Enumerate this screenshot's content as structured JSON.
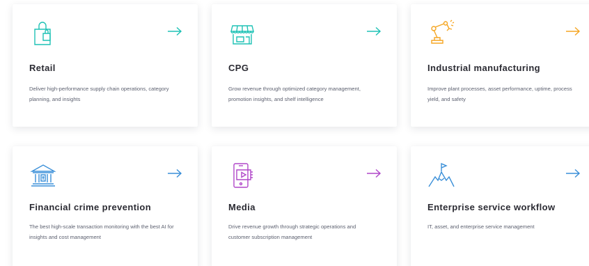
{
  "cards": [
    {
      "title": "Retail",
      "description": "Deliver high-performance supply chain operations, category planning, and insights",
      "icon": "shopping-bag-icon",
      "accent": "#1fc2b5"
    },
    {
      "title": "CPG",
      "description": "Grow revenue through optimized category management, promotion insights, and shelf intelligence",
      "icon": "storefront-icon",
      "accent": "#1fc2b5"
    },
    {
      "title": "Industrial manufacturing",
      "description": "Improve plant processes, asset performance, uptime, process yield, and safety",
      "icon": "robotic-arm-icon",
      "accent": "#f5a623"
    },
    {
      "title": "Financial crime prevention",
      "description": "The best high-scale transaction monitoring with the best AI for insights and cost management",
      "icon": "bank-icon",
      "accent": "#3a8fd8"
    },
    {
      "title": "Media",
      "description": "Drive revenue growth through strategic operations and customer subscription management",
      "icon": "mobile-play-icon",
      "accent": "#b047c9"
    },
    {
      "title": "Enterprise service workflow",
      "description": "IT, asset, and enterprise service management",
      "icon": "mountain-flag-icon",
      "accent": "#3a8fd8"
    }
  ]
}
